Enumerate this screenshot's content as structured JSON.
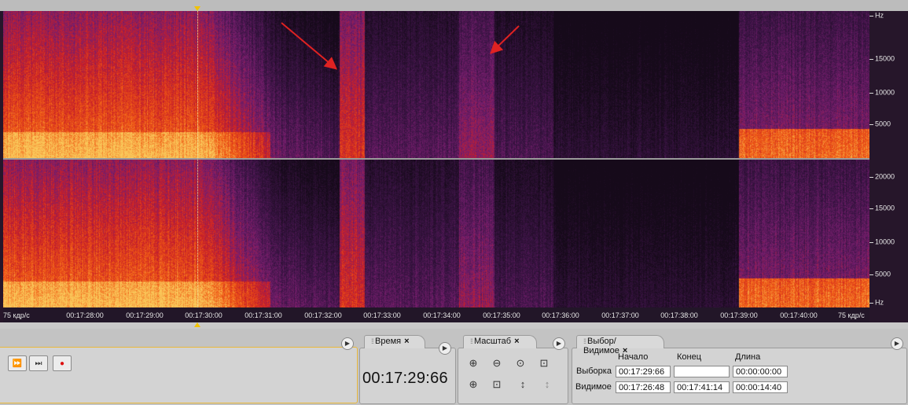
{
  "spectrogram": {
    "frequency_unit": "Hz",
    "channel_top_frequency_labels": [
      "Hz",
      "15000",
      "10000",
      "5000"
    ],
    "channel_bottom_frequency_labels": [
      "20000",
      "15000",
      "10000",
      "5000",
      "Hz"
    ],
    "frame_rate_left": "75 кдр/с",
    "frame_rate_right": "75 кдр/с",
    "time_labels": [
      "00:17:28:00",
      "00:17:29:00",
      "00:17:30:00",
      "00:17:31:00",
      "00:17:32:00",
      "00:17:33:00",
      "00:17:34:00",
      "00:17:35:00",
      "00:17:36:00",
      "00:17:37:00",
      "00:17:38:00",
      "00:17:39:00",
      "00:17:40:00"
    ],
    "colors": {
      "background": "#26162a",
      "hot": "#f7b032",
      "warm": "#d92a1c",
      "mid": "#6b1f6e",
      "cursor": "#f2c200",
      "annotation_arrow": "#e02222"
    }
  },
  "transport": {
    "buttons": [
      "fast-forward",
      "skip-to-end",
      "record"
    ]
  },
  "time_panel": {
    "tab_label": "Время",
    "close": "×",
    "current_time": "00:17:29:66"
  },
  "zoom_panel": {
    "tab_label": "Масштаб",
    "close": "×",
    "icons": [
      "zoom-in-horizontal-icon",
      "zoom-out-horizontal-icon",
      "zoom-selection-icon",
      "zoom-full-icon",
      "zoom-in-left-icon",
      "zoom-in-right-icon",
      "zoom-in-vertical-icon",
      "zoom-out-vertical-icon"
    ]
  },
  "selection_panel": {
    "tab_label": "Выбор/Видимое",
    "close": "×",
    "headers": {
      "start": "Начало",
      "end": "Конец",
      "length": "Длина"
    },
    "selection": {
      "label": "Выборка",
      "start": "00:17:29:66",
      "end": "",
      "length": "00:00:00:00"
    },
    "visible": {
      "label": "Видимое",
      "start": "00:17:26:48",
      "end": "00:17:41:14",
      "length": "00:00:14:40"
    }
  }
}
